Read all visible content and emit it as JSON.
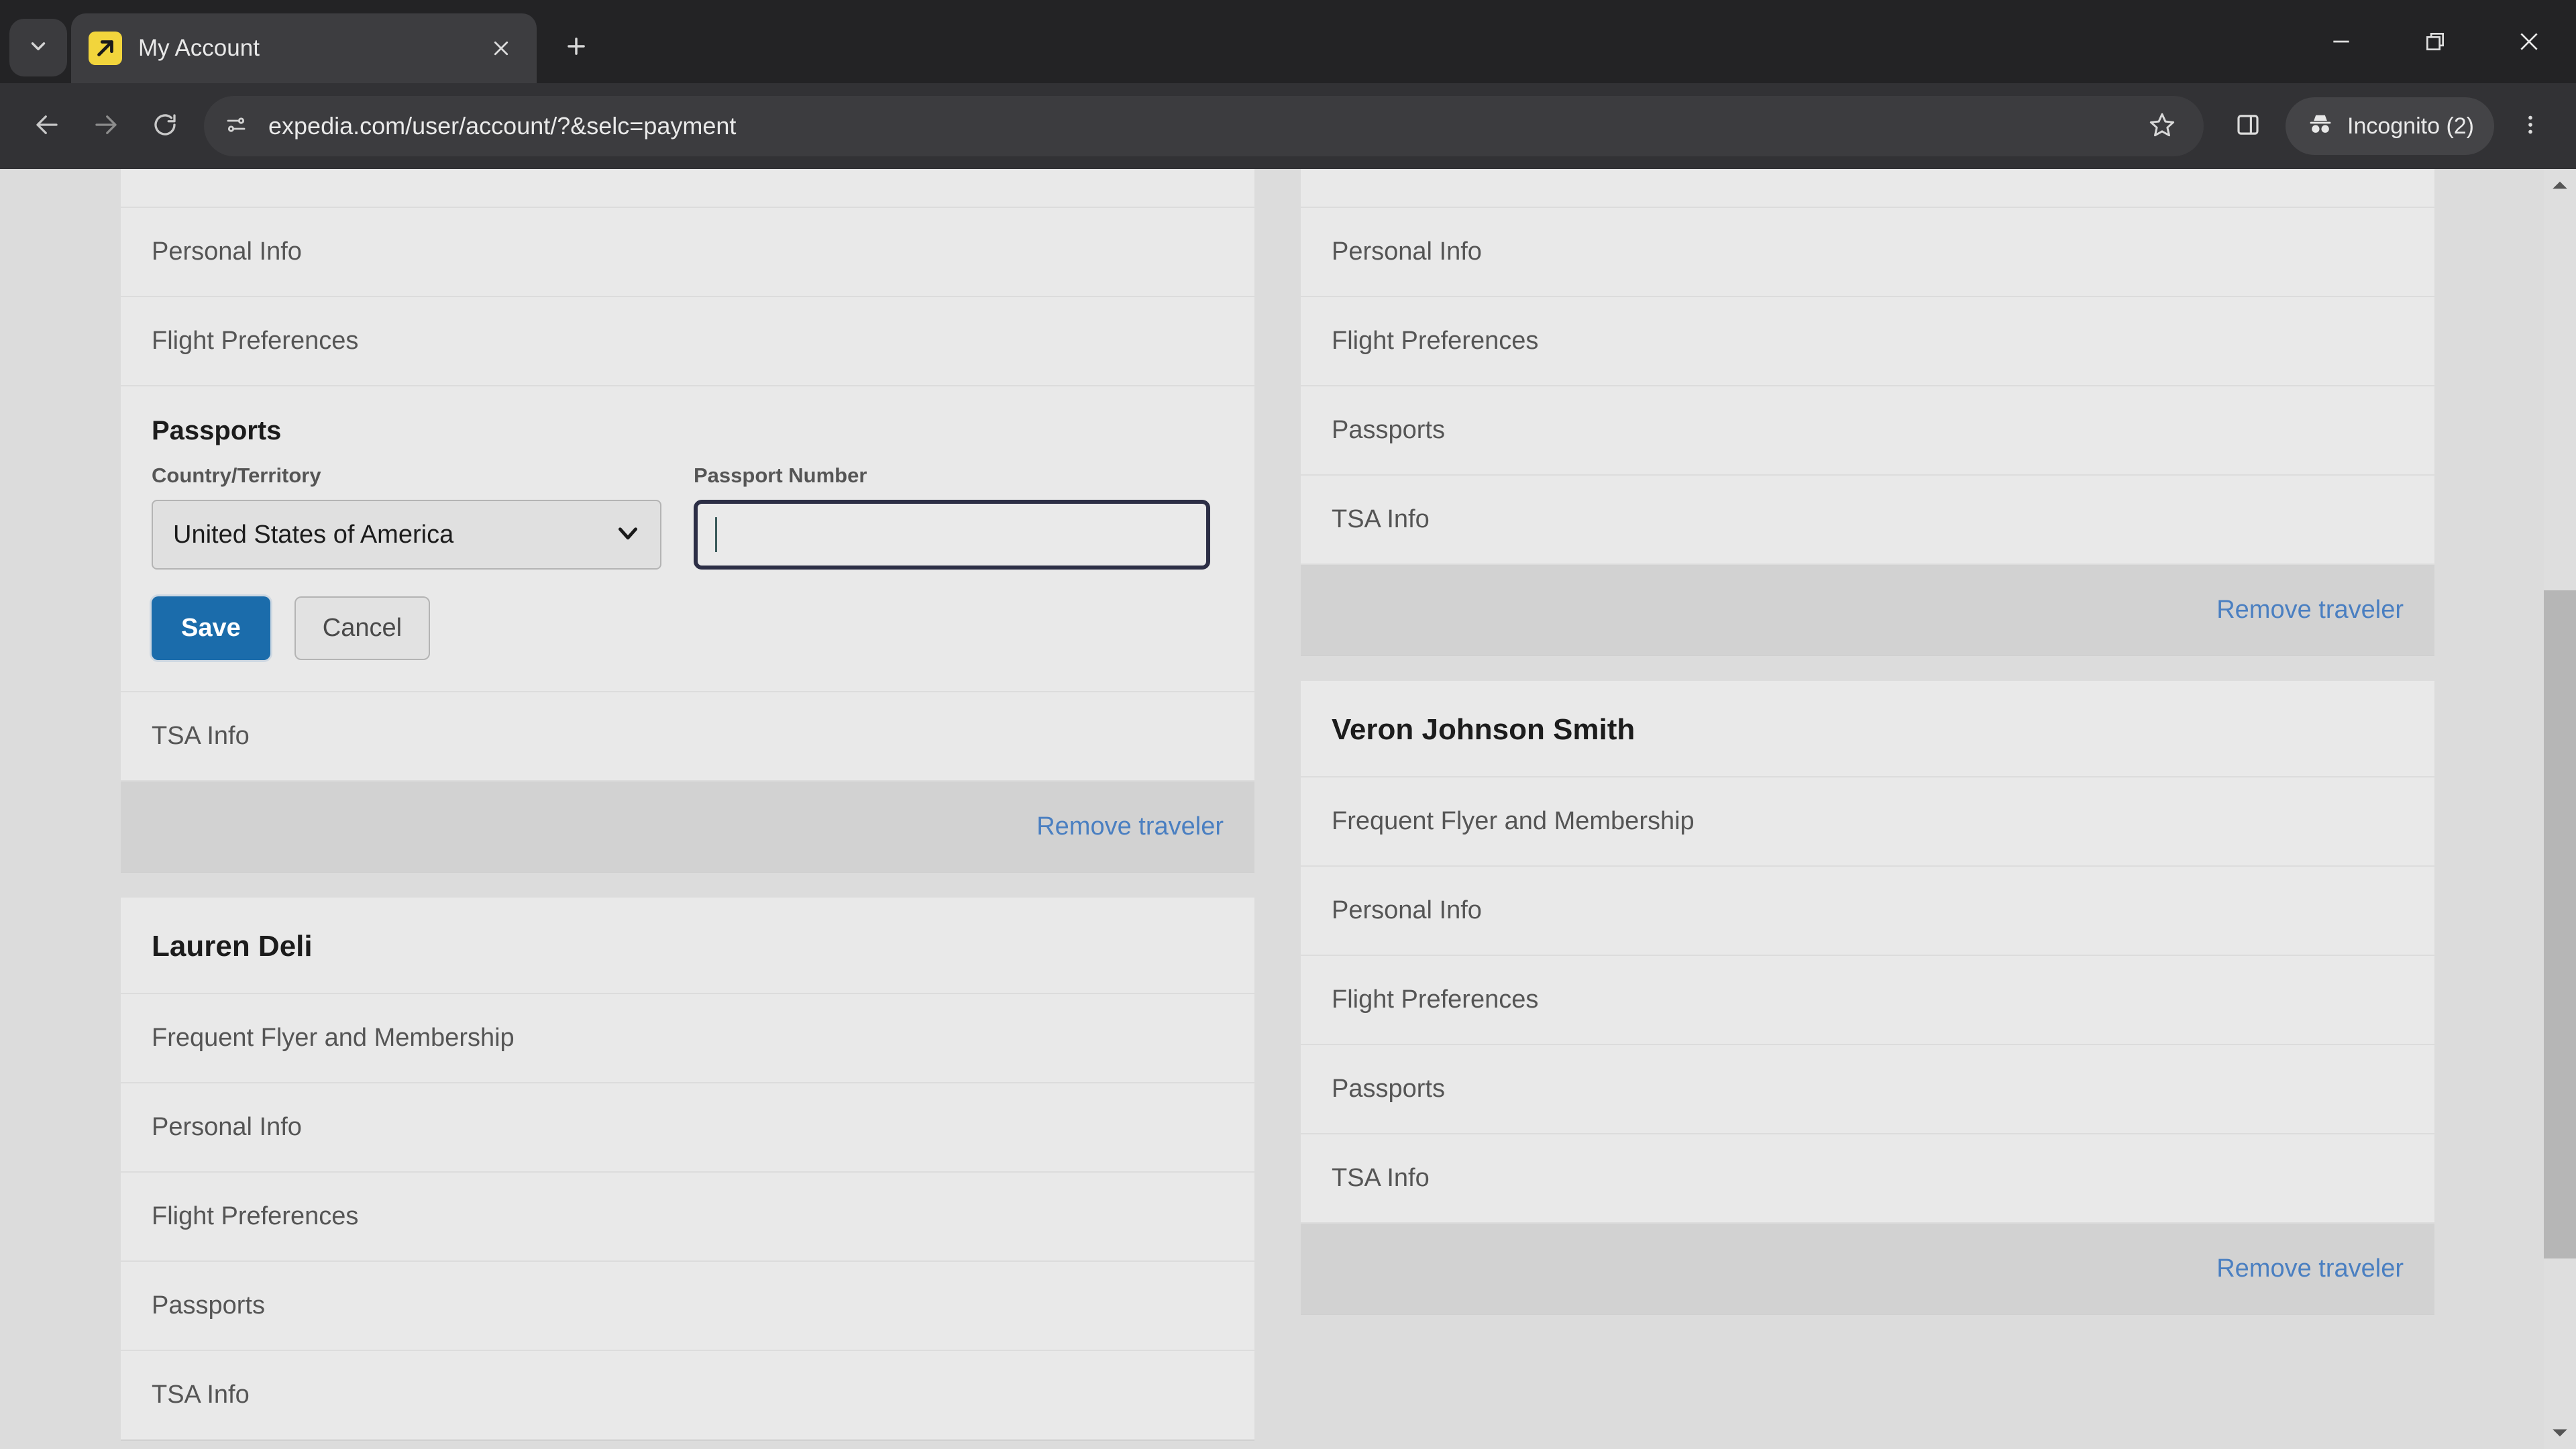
{
  "window": {
    "minimize_icon": "minimize-icon",
    "restore_icon": "restore-icon",
    "close_icon": "close-icon"
  },
  "tabstrip": {
    "tab_search_icon": "chevron-down-icon",
    "new_tab_icon": "plus-icon",
    "tabs": [
      {
        "title": "My Account",
        "favicon": "expedia-favicon",
        "close_icon": "close-icon",
        "active": true
      }
    ]
  },
  "toolbar": {
    "back_icon": "arrow-left-icon",
    "forward_icon": "arrow-right-icon",
    "reload_icon": "reload-icon",
    "site_info_icon": "tune-icon",
    "url": "expedia.com/user/account/?&selc=payment",
    "url_placeholder": "Search Google or type a URL",
    "bookmark_icon": "star-icon",
    "side_panel_icon": "side-panel-icon",
    "profile_icon": "incognito-icon",
    "profile_label": "Incognito (2)",
    "menu_icon": "more-vertical-icon"
  },
  "colors": {
    "accent_blue": "#1b6cab",
    "link_blue": "#4a7fc1",
    "page_bg": "#dcdcdc",
    "card_bg": "#e9e9e9",
    "row_divider": "#dcdcdc",
    "remove_row_bg": "#d2d2d2",
    "input_focus_border": "#2c2e45",
    "favicon_yellow": "#f2d53c"
  },
  "page": {
    "left_column": {
      "traveler_editing": {
        "rows_above": [
          "Personal Info",
          "Flight Preferences"
        ],
        "passport_section": {
          "heading": "Passports",
          "country_label": "Country/Territory",
          "country_value": "United States of America",
          "country_chevron_icon": "chevron-down-icon",
          "passport_number_label": "Passport Number",
          "passport_number_value": "",
          "passport_number_placeholder": "",
          "save_label": "Save",
          "cancel_label": "Cancel"
        },
        "rows_below": [
          "TSA Info"
        ],
        "remove_label": "Remove traveler"
      },
      "traveler_lauren": {
        "name": "Lauren Deli",
        "rows": [
          "Frequent Flyer and Membership",
          "Personal Info",
          "Flight Preferences",
          "Passports",
          "TSA Info"
        ]
      }
    },
    "right_column": {
      "traveler_top": {
        "rows": [
          "Personal Info",
          "Flight Preferences",
          "Passports",
          "TSA Info"
        ],
        "remove_label": "Remove traveler"
      },
      "traveler_veron": {
        "name": "Veron Johnson Smith",
        "rows": [
          "Frequent Flyer and Membership",
          "Personal Info",
          "Flight Preferences",
          "Passports",
          "TSA Info"
        ],
        "remove_label": "Remove traveler"
      }
    },
    "scrollbar": {
      "up_arrow_icon": "caret-up-icon",
      "down_arrow_icon": "caret-down-icon"
    }
  }
}
